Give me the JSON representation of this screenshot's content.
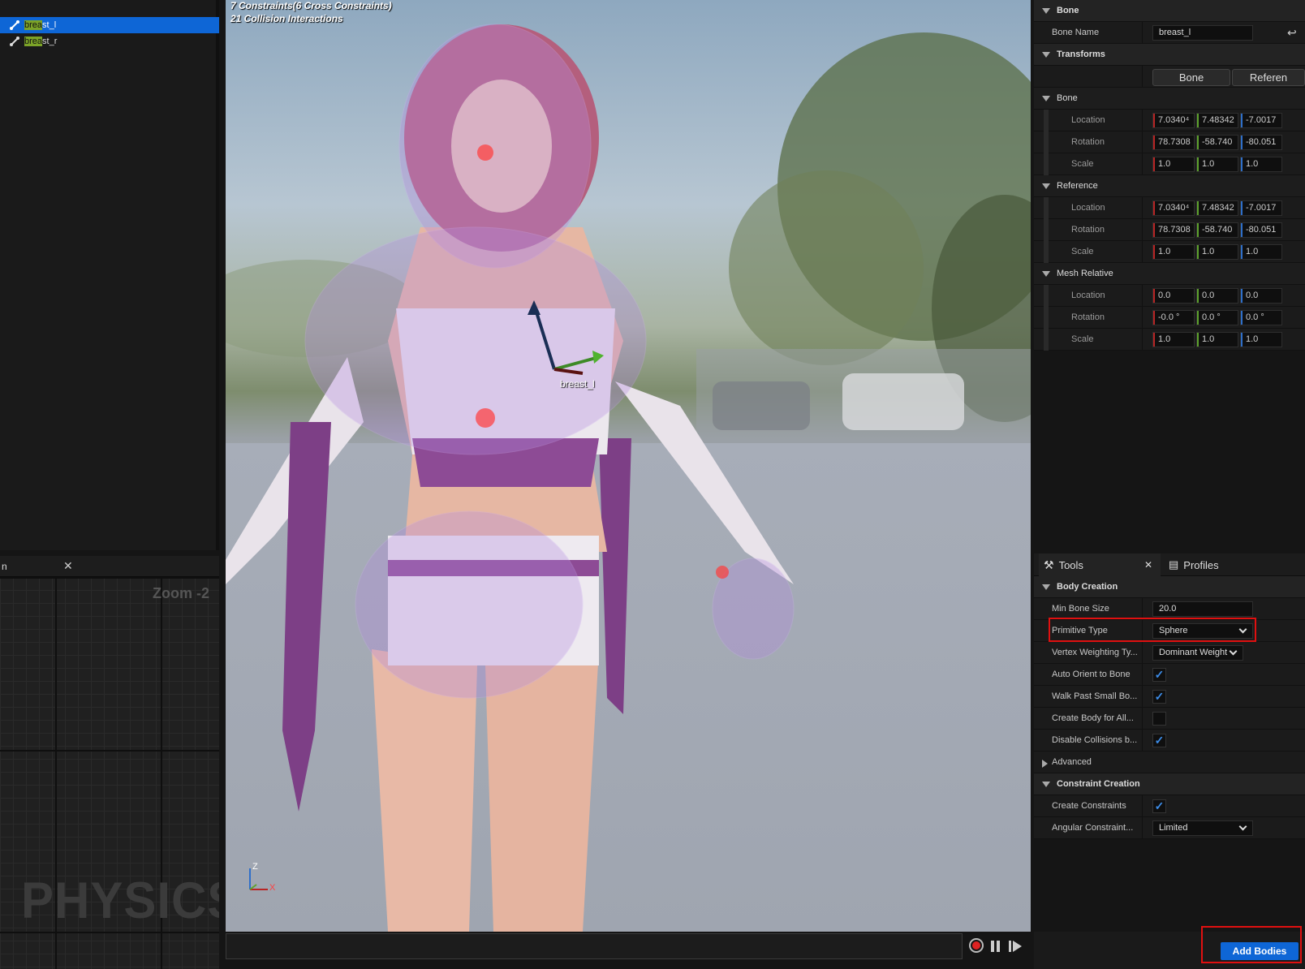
{
  "tree": {
    "items": [
      {
        "label_hl": "brea",
        "label_rest": "st_l",
        "selected": true
      },
      {
        "label_hl": "brea",
        "label_rest": "st_r",
        "selected": false
      }
    ]
  },
  "graph": {
    "tab_label": "n",
    "zoom": "Zoom -2",
    "watermark": "PHYSICS"
  },
  "viewport": {
    "info_line1": "7 Constraints(6 Cross Constraints)",
    "info_line2": "21 Collision Interactions",
    "bone_label": "breast_l",
    "axis_z": "Z",
    "axis_x": "X"
  },
  "details": {
    "bone_section": "Bone",
    "bone_name_label": "Bone Name",
    "bone_name_value": "breast_l",
    "transforms_section": "Transforms",
    "seg_bone": "Bone",
    "seg_reference": "Referen",
    "groups": [
      {
        "title": "Bone",
        "rows": [
          {
            "label": "Location",
            "x": "7.0340⁴",
            "y": "7.48342",
            "z": "-7.0017"
          },
          {
            "label": "Rotation",
            "x": "78.7308",
            "y": "-58.740",
            "z": "-80.051"
          },
          {
            "label": "Scale",
            "x": "1.0",
            "y": "1.0",
            "z": "1.0"
          }
        ]
      },
      {
        "title": "Reference",
        "rows": [
          {
            "label": "Location",
            "x": "7.0340⁴",
            "y": "7.48342",
            "z": "-7.0017"
          },
          {
            "label": "Rotation",
            "x": "78.7308",
            "y": "-58.740",
            "z": "-80.051"
          },
          {
            "label": "Scale",
            "x": "1.0",
            "y": "1.0",
            "z": "1.0"
          }
        ]
      },
      {
        "title": "Mesh Relative",
        "rows": [
          {
            "label": "Location",
            "x": "0.0",
            "y": "0.0",
            "z": "0.0"
          },
          {
            "label": "Rotation",
            "x": "-0.0 °",
            "y": "0.0 °",
            "z": "0.0 °"
          },
          {
            "label": "Scale",
            "x": "1.0",
            "y": "1.0",
            "z": "1.0"
          }
        ]
      }
    ]
  },
  "tools": {
    "tab_tools": "Tools",
    "tab_profiles": "Profiles",
    "body_creation": "Body Creation",
    "min_bone_size_label": "Min Bone Size",
    "min_bone_size_value": "20.0",
    "primitive_type_label": "Primitive Type",
    "primitive_type_value": "Sphere",
    "vertex_weighting_label": "Vertex Weighting Ty...",
    "vertex_weighting_value": "Dominant Weight",
    "auto_orient_label": "Auto Orient to Bone",
    "auto_orient": true,
    "walk_past_label": "Walk Past Small Bo...",
    "walk_past": true,
    "create_body_label": "Create Body for All...",
    "create_body": false,
    "disable_collisions_label": "Disable Collisions b...",
    "disable_collisions": true,
    "advanced": "Advanced",
    "constraint_creation": "Constraint Creation",
    "create_constraints_label": "Create Constraints",
    "create_constraints": true,
    "angular_label": "Angular Constraint...",
    "angular_value": "Limited",
    "add_bodies": "Add Bodies"
  },
  "colors": {
    "accent": "#0e66d6",
    "highlight": "#e01010",
    "axis_x": "#b82525",
    "axis_y": "#5ea22d",
    "axis_z": "#2f6fc9"
  }
}
